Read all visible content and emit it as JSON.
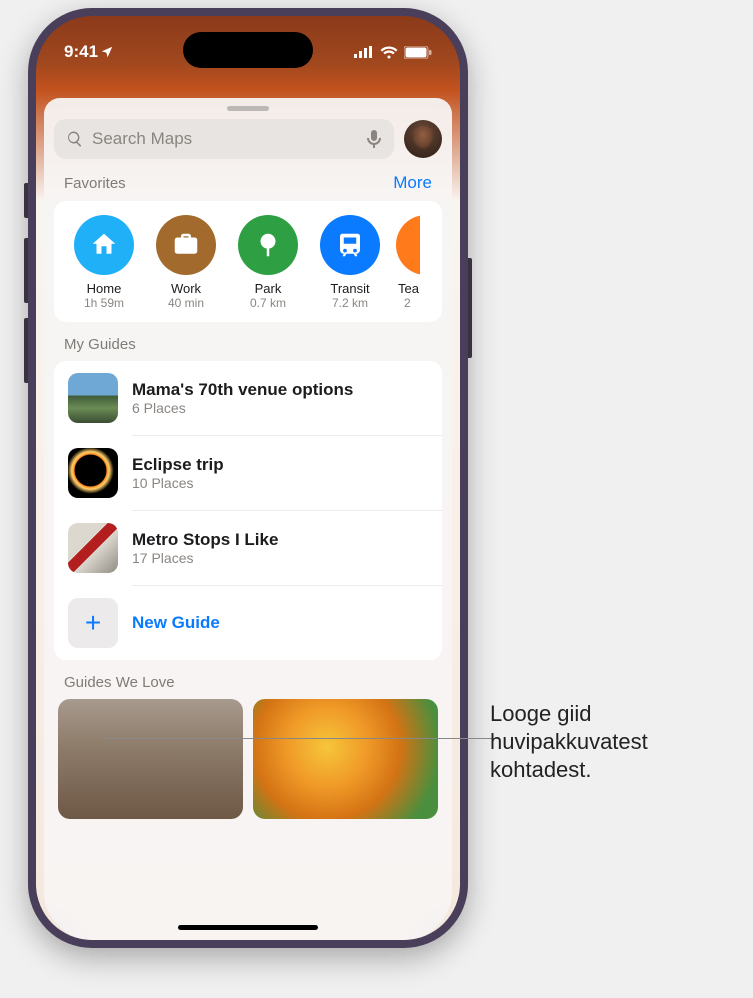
{
  "status": {
    "time": "9:41"
  },
  "search": {
    "placeholder": "Search Maps"
  },
  "favorites": {
    "title": "Favorites",
    "more": "More",
    "items": [
      {
        "label": "Home",
        "sub": "1h 59m",
        "color": "#1fb0f7",
        "icon": "home"
      },
      {
        "label": "Work",
        "sub": "40 min",
        "color": "#a36a2e",
        "icon": "briefcase"
      },
      {
        "label": "Park",
        "sub": "0.7 km",
        "color": "#2ea043",
        "icon": "tree"
      },
      {
        "label": "Transit",
        "sub": "7.2 km",
        "color": "#0a7aff",
        "icon": "transit"
      },
      {
        "label": "Tea",
        "sub": "2",
        "color": "#ff7a1a",
        "icon": "cup"
      }
    ]
  },
  "myguides": {
    "title": "My Guides",
    "items": [
      {
        "title": "Mama's 70th venue options",
        "sub": "6 Places"
      },
      {
        "title": "Eclipse trip",
        "sub": "10 Places"
      },
      {
        "title": "Metro Stops I Like",
        "sub": "17 Places"
      }
    ],
    "new": "New Guide"
  },
  "guideslove": {
    "title": "Guides We Love"
  },
  "callout": "Looge giid huvipakkuvatest kohtadest."
}
